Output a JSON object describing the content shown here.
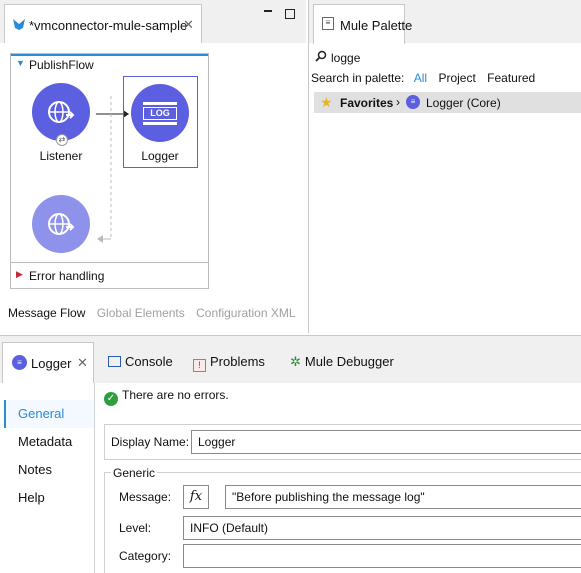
{
  "editor": {
    "tab_title": "*vmconnector-mule-sample",
    "flow_name": "PublishFlow",
    "nodes": {
      "listener_label": "Listener",
      "logger_label": "Logger",
      "logger_icon_text": "LOG"
    },
    "error_handling": "Error handling",
    "bottom_tabs": {
      "message_flow": "Message Flow",
      "global_elements": "Global Elements",
      "configuration_xml": "Configuration XML"
    }
  },
  "palette": {
    "tab_title": "Mule Palette",
    "search_value": "logge",
    "search_in_label": "Search in palette:",
    "filters": {
      "all": "All",
      "project": "Project",
      "featured": "Featured"
    },
    "favorites_label": "Favorites",
    "result_label": "Logger (Core)"
  },
  "properties": {
    "tabs": {
      "logger": "Logger",
      "console": "Console",
      "problems": "Problems",
      "debugger": "Mule Debugger"
    },
    "status_message": "There are no errors.",
    "side_nav": {
      "general": "General",
      "metadata": "Metadata",
      "notes": "Notes",
      "help": "Help"
    },
    "display_name_label": "Display Name:",
    "display_name_value": "Logger",
    "generic_group": "Generic",
    "message_label": "Message:",
    "fx_label": "fx",
    "message_value": "\"Before publishing the message log\"",
    "level_label": "Level:",
    "level_value": "INFO (Default)",
    "category_label": "Category:",
    "category_value": ""
  },
  "colors": {
    "accent": "#2a8bd8",
    "node_primary": "#5b5fe0",
    "node_light": "#8f92ea",
    "success": "#2e9e3e"
  }
}
